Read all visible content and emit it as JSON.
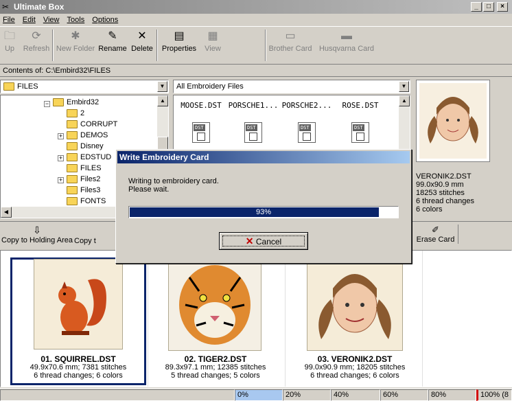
{
  "window": {
    "title": "Ultimate Box",
    "min": "_",
    "max": "□",
    "close": "×"
  },
  "menu": [
    "File",
    "Edit",
    "View",
    "Tools",
    "Options"
  ],
  "toolbar": {
    "up": "Up",
    "refresh": "Refresh",
    "new_folder": "New Folder",
    "rename": "Rename",
    "delete": "Delete",
    "properties": "Properties",
    "view": "View",
    "brother_card": "Brother Card",
    "husqvarna_card": "Husqvarna Card"
  },
  "contents_label": "Contents of: C:\\Embird32\\FILES",
  "folder_combo": "FILES",
  "filter_combo": "All Embroidery Files",
  "tree": [
    "Embird32",
    "2",
    "CORRUPT",
    "DEMOS",
    "Disney",
    "EDSTUD",
    "FILES",
    "Files2",
    "Files3",
    "FONTS"
  ],
  "files": [
    "MOOSE.DST",
    "PORSCHE1...",
    "PORSCHE2...",
    "ROSE.DST"
  ],
  "file_icon_label": "DST",
  "preview": {
    "name": "VERONIK2.DST",
    "size": "99.0x90.9 mm",
    "stitches": "18253 stitches",
    "changes": "6 thread changes",
    "colors": "6 colors"
  },
  "actions": {
    "copy_holding": "Copy to Holding Area",
    "copy_to": "Copy t",
    "erase_card": "Erase Card"
  },
  "cards": [
    {
      "name": "01. SQUIRREL.DST",
      "line1": "49.9x70.6 mm; 7381 stitches",
      "line2": "6 thread changes; 6 colors"
    },
    {
      "name": "02. TIGER2.DST",
      "line1": "89.3x97.1 mm; 12385 stitches",
      "line2": "5 thread changes; 5 colors"
    },
    {
      "name": "03. VERONIK2.DST",
      "line1": "99.0x90.9 mm; 18205 stitches",
      "line2": "6 thread changes; 6 colors"
    }
  ],
  "dialog": {
    "title": "Write Embroidery Card",
    "message1": "Writing to embroidery card.",
    "message2": "Please wait.",
    "progress_label": "93%",
    "progress_value": 0.93,
    "cancel": "Cancel"
  },
  "status_scale": [
    "0%",
    "20%",
    "40%",
    "60%",
    "80%",
    "100% (8"
  ],
  "colors": {
    "title_active": "#0a246a",
    "progress": "#0a246a",
    "selection": "#0a246a"
  }
}
